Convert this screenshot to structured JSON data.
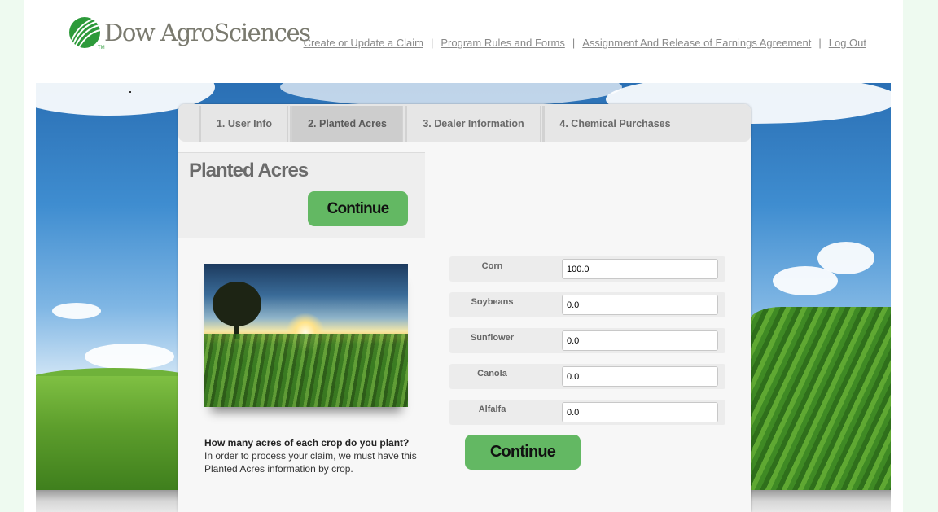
{
  "header": {
    "logo_text": "Dow AgroSciences",
    "logo_tm": "TM",
    "links": [
      "Create or Update a Claim",
      "Program Rules and Forms",
      "Assignment And Release of Earnings Agreement",
      "Log Out"
    ],
    "separator": "|"
  },
  "tabs": [
    {
      "label": "1. User Info",
      "active": false
    },
    {
      "label": "2. Planted Acres",
      "active": true
    },
    {
      "label": "3. Dealer Information",
      "active": false
    },
    {
      "label": "4. Chemical Purchases",
      "active": false
    }
  ],
  "section": {
    "title": "Planted Acres",
    "continue_top": "Continue",
    "continue_bottom": "Continue"
  },
  "crops": [
    {
      "label": "Corn",
      "value": "100.0"
    },
    {
      "label": "Soybeans",
      "value": "0.0"
    },
    {
      "label": "Sunflower",
      "value": "0.0"
    },
    {
      "label": "Canola",
      "value": "0.0"
    },
    {
      "label": "Alfalfa",
      "value": "0.0"
    }
  ],
  "question": {
    "heading": "How many acres of each crop do you plant?",
    "body": "In order to process your claim, we must have this Planted Acres information by crop."
  },
  "colors": {
    "brand_green": "#2d9a3a",
    "button_green": "#63b863",
    "link_gray": "#8a8a8a"
  }
}
